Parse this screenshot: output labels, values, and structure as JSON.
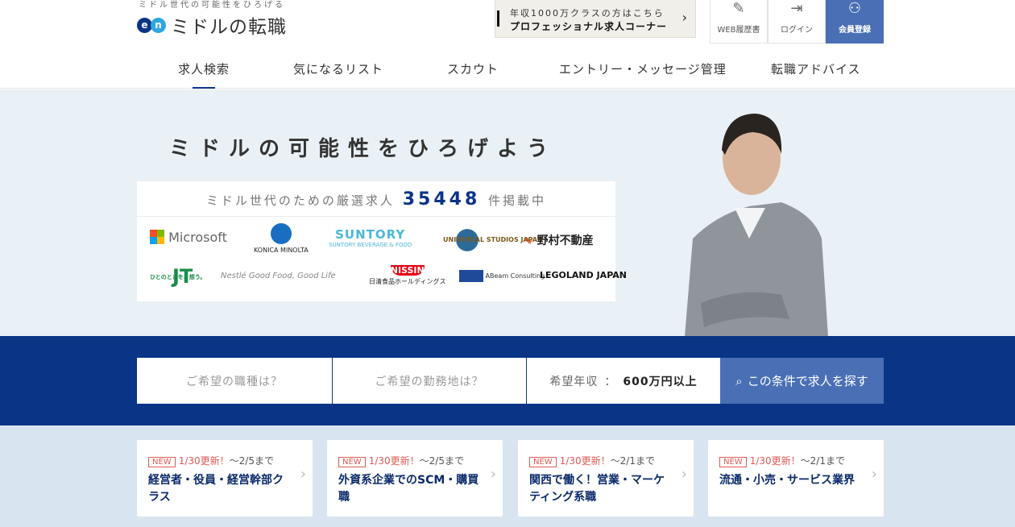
{
  "header": {
    "tagline": "ミドル世代の可能性をひろげる",
    "logo_text": "ミドルの転職",
    "logo_mark": "en",
    "pro_banner": {
      "line1": "年収1000万クラスの方はこちら",
      "line2": "プロフェッショナル求人コーナー"
    },
    "buttons": [
      {
        "label": "WEB履歴書",
        "icon": "pencil-icon"
      },
      {
        "label": "ログイン",
        "icon": "login-icon"
      },
      {
        "label": "会員登録",
        "icon": "user-icon"
      }
    ]
  },
  "nav": [
    {
      "label": "求人検索",
      "active": true
    },
    {
      "label": "気になるリスト"
    },
    {
      "label": "スカウト"
    },
    {
      "label": "エントリー・メッセージ管理"
    },
    {
      "label": "転職アドバイス"
    }
  ],
  "hero": {
    "catch": "ミドルの可能性をひろげよう",
    "count_prefix": "ミドル世代のための厳選求人",
    "count": "35448",
    "count_suffix": "件掲載中",
    "logos": [
      "Microsoft",
      "KONICA MINOLTA",
      "SUNTORY",
      "SUNTORY BEVERAGE & FOOD",
      "UNIVERSAL STUDIOS JAPAN",
      "野村不動産",
      "JT",
      "ひとのときを、想う。",
      "Nestlé Good Food, Good Life",
      "NISSIN",
      "日清食品ホールディングス",
      "ABeam Consulting",
      "LEGOLAND JAPAN"
    ]
  },
  "search": {
    "job_placeholder": "ご希望の職種は？",
    "location_placeholder": "ご希望の勤務地は？",
    "salary_label": "希望年収",
    "salary_value": "600万円以上",
    "button": "この条件で求人を探す"
  },
  "cards": [
    {
      "badge": "NEW",
      "updated": "1/30更新！",
      "until": "～2/5まで",
      "title": "経営者・役員・経営幹部クラス"
    },
    {
      "badge": "NEW",
      "updated": "1/30更新！",
      "until": "～2/5まで",
      "title": "外資系企業でのSCM・購買職"
    },
    {
      "badge": "NEW",
      "updated": "1/30更新！",
      "until": "～2/1まで",
      "title": "関西で働く！営業・マーケティング系職"
    },
    {
      "badge": "NEW",
      "updated": "1/30更新！",
      "until": "～2/1まで",
      "title": "流通・小売・サービス業界"
    }
  ]
}
